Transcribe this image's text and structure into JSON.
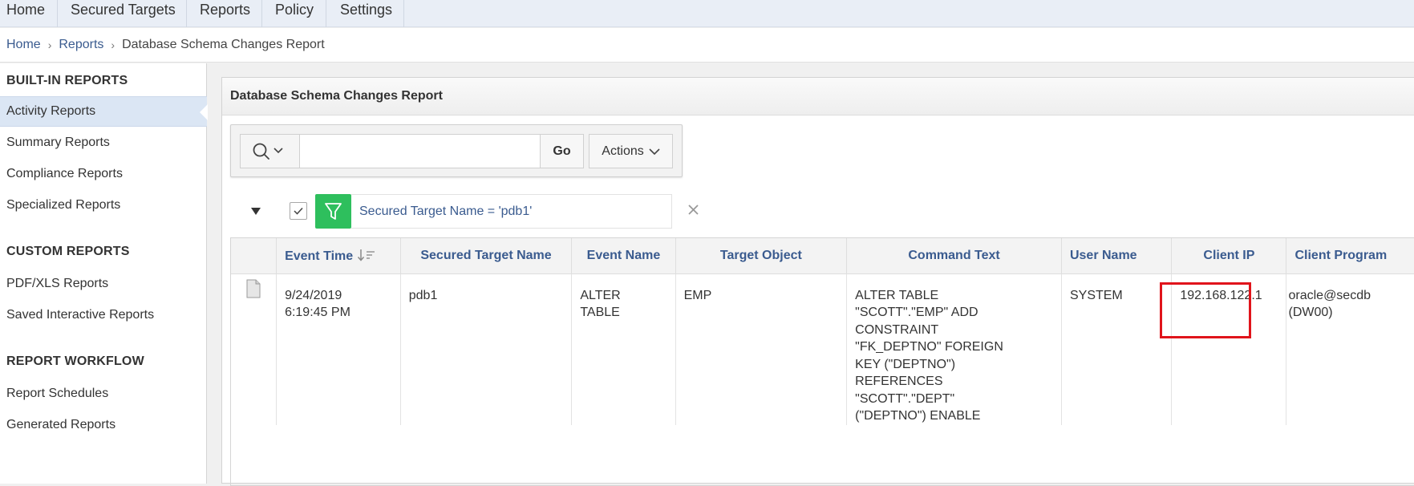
{
  "nav": {
    "tabs": [
      {
        "label": "Home"
      },
      {
        "label": "Secured Targets"
      },
      {
        "label": "Reports"
      },
      {
        "label": "Policy"
      },
      {
        "label": "Settings"
      }
    ]
  },
  "breadcrumb": {
    "home": "Home",
    "reports": "Reports",
    "current": "Database Schema Changes Report",
    "separator": "›"
  },
  "sidebar": {
    "built_in_heading": "BUILT-IN REPORTS",
    "built_in_items": [
      {
        "label": "Activity Reports",
        "active": true
      },
      {
        "label": "Summary Reports"
      },
      {
        "label": "Compliance Reports"
      },
      {
        "label": "Specialized Reports"
      }
    ],
    "custom_heading": "CUSTOM REPORTS",
    "custom_items": [
      {
        "label": "PDF/XLS Reports"
      },
      {
        "label": "Saved Interactive Reports"
      }
    ],
    "workflow_heading": "REPORT WORKFLOW",
    "workflow_items": [
      {
        "label": "Report Schedules"
      },
      {
        "label": "Generated Reports"
      }
    ]
  },
  "report": {
    "title": "Database Schema Changes Report",
    "search": {
      "value": "",
      "placeholder": ""
    },
    "go_label": "Go",
    "actions_label": "Actions",
    "filter": {
      "text": "Secured Target Name = 'pdb1'",
      "enabled": true
    },
    "columns": [
      "",
      "Event Time",
      "Secured Target Name",
      "Event Name",
      "Target Object",
      "Command Text",
      "User Name",
      "Client IP",
      "Client Program"
    ],
    "rows": [
      {
        "event_time": "9/24/2019\n6:19:45 PM",
        "secured_target_name": "pdb1",
        "event_name": "ALTER\nTABLE",
        "target_object": "EMP",
        "command_text": "ALTER TABLE\n\"SCOTT\".\"EMP\" ADD\nCONSTRAINT\n\"FK_DEPTNO\" FOREIGN\nKEY (\"DEPTNO\")\nREFERENCES\n\"SCOTT\".\"DEPT\"\n(\"DEPTNO\") ENABLE",
        "user_name": "SYSTEM",
        "client_ip": "192.168.122.1",
        "client_program": "oracle@secdb\n(DW00)"
      }
    ]
  },
  "colors": {
    "link": "#3a5b8f",
    "filter_green": "#2ebf5d",
    "highlight_red": "#e0141b",
    "active_item": "#dbe6f4"
  }
}
